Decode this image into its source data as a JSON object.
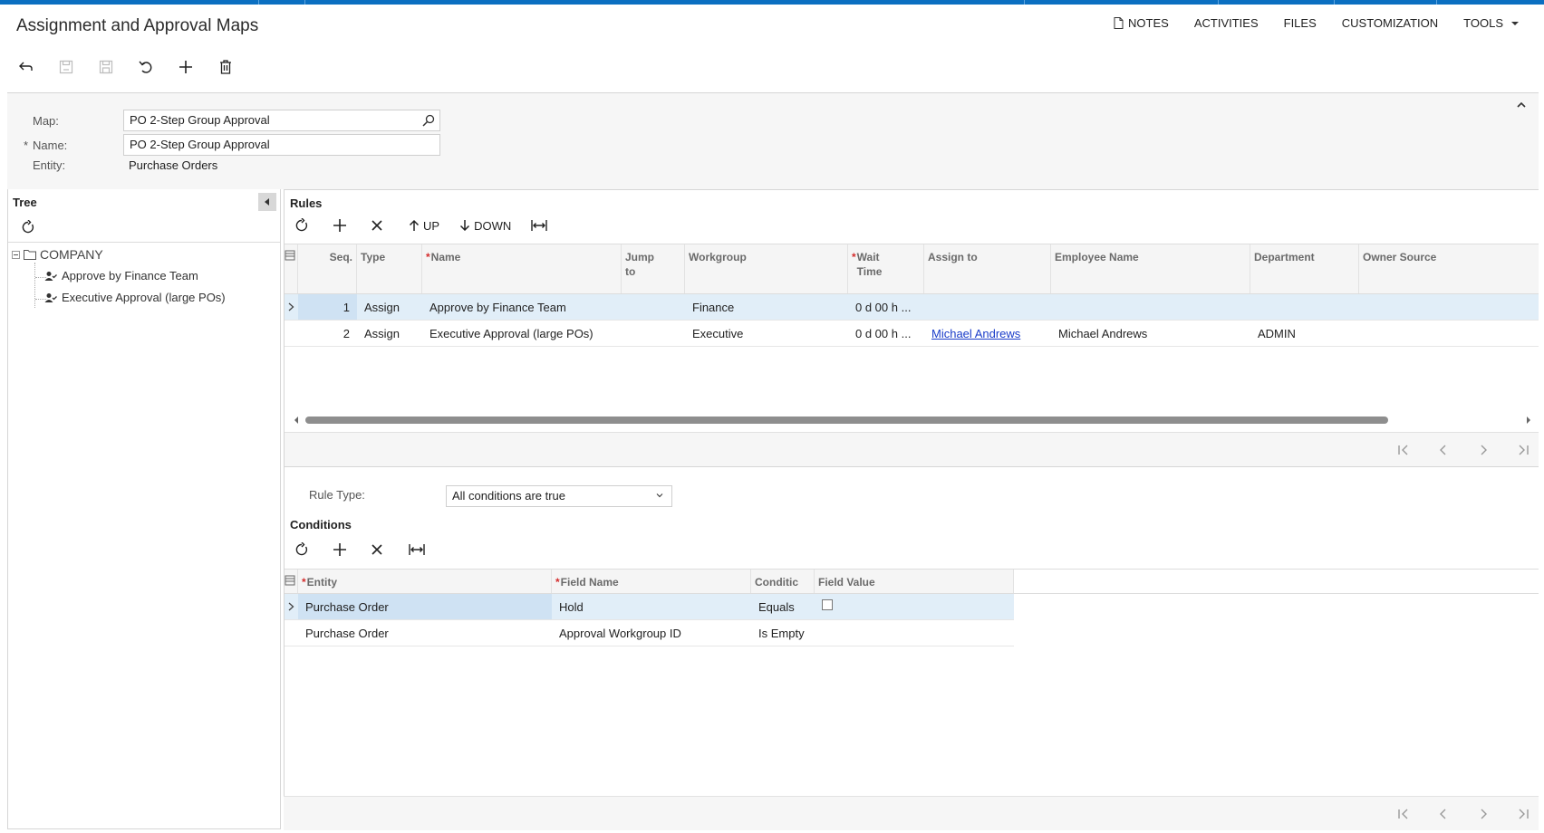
{
  "header": {
    "title": "Assignment and Approval Maps",
    "links": [
      {
        "label": "NOTES",
        "icon": "document-icon"
      },
      {
        "label": "ACTIVITIES"
      },
      {
        "label": "FILES"
      },
      {
        "label": "CUSTOMIZATION"
      },
      {
        "label": "TOOLS",
        "dropdown": true
      }
    ]
  },
  "toolbar": {
    "buttons": [
      {
        "name": "back-button",
        "icon": "back-arrow-icon",
        "enabled": true
      },
      {
        "name": "save-close-button",
        "icon": "save-close-icon",
        "enabled": false
      },
      {
        "name": "save-button",
        "icon": "save-icon",
        "enabled": false
      },
      {
        "name": "undo-button",
        "icon": "undo-icon",
        "enabled": true
      },
      {
        "name": "add-button",
        "icon": "plus-icon",
        "enabled": true
      },
      {
        "name": "delete-button",
        "icon": "trash-icon",
        "enabled": true
      }
    ]
  },
  "form": {
    "map_label": "Map:",
    "map_value": "PO 2-Step Group Approval",
    "name_required": "*",
    "name_label": "Name:",
    "name_value": "PO 2-Step Group Approval",
    "entity_label": "Entity:",
    "entity_value": "Purchase Orders"
  },
  "tree": {
    "title": "Tree",
    "root": "COMPANY",
    "children": [
      "Approve by Finance Team",
      "Executive Approval (large POs)"
    ]
  },
  "rules": {
    "title": "Rules",
    "toolbar": {
      "up": "UP",
      "down": "DOWN"
    },
    "columns": [
      {
        "label": "Seq.",
        "required": false
      },
      {
        "label": "Type",
        "required": false
      },
      {
        "label": "Name",
        "required": true
      },
      {
        "label": "Jump to",
        "required": false
      },
      {
        "label": "Workgroup",
        "required": false
      },
      {
        "label": "Wait Time",
        "required": true
      },
      {
        "label": "Assign to",
        "required": false
      },
      {
        "label": "Employee Name",
        "required": false
      },
      {
        "label": "Department",
        "required": false
      },
      {
        "label": "Owner Source",
        "required": false
      }
    ],
    "rows": [
      {
        "seq": "1",
        "type": "Assign",
        "name": "Approve by Finance Team",
        "jump": "",
        "workgroup": "Finance",
        "wait": "0 d 00 h ...",
        "assign": "",
        "employee": "",
        "department": "",
        "owner": "",
        "selected": true
      },
      {
        "seq": "2",
        "type": "Assign",
        "name": "Executive Approval (large POs)",
        "jump": "",
        "workgroup": "Executive",
        "wait": "0 d 00 h ...",
        "assign": "Michael Andrews",
        "employee": "Michael Andrews",
        "department": "ADMIN",
        "owner": "",
        "selected": false
      }
    ]
  },
  "rule_type": {
    "label": "Rule Type:",
    "value": "All conditions are true"
  },
  "conditions": {
    "title": "Conditions",
    "columns": [
      {
        "label": "Entity",
        "required": true
      },
      {
        "label": "Field Name",
        "required": true
      },
      {
        "label": "Conditic",
        "required": false
      },
      {
        "label": "Field Value",
        "required": false
      }
    ],
    "rows": [
      {
        "entity": "Purchase Order",
        "field": "Hold",
        "condition": "Equals",
        "value_checkbox": false,
        "selected": true
      },
      {
        "entity": "Purchase Order",
        "field": "Approval Workgroup ID",
        "condition": "Is Empty",
        "value_checkbox": null,
        "selected": false
      }
    ]
  },
  "colors": {
    "accent": "#0b6fc1",
    "selected_row": "#e1eef8",
    "required": "#d42d2d",
    "link": "#1a3cc9"
  }
}
